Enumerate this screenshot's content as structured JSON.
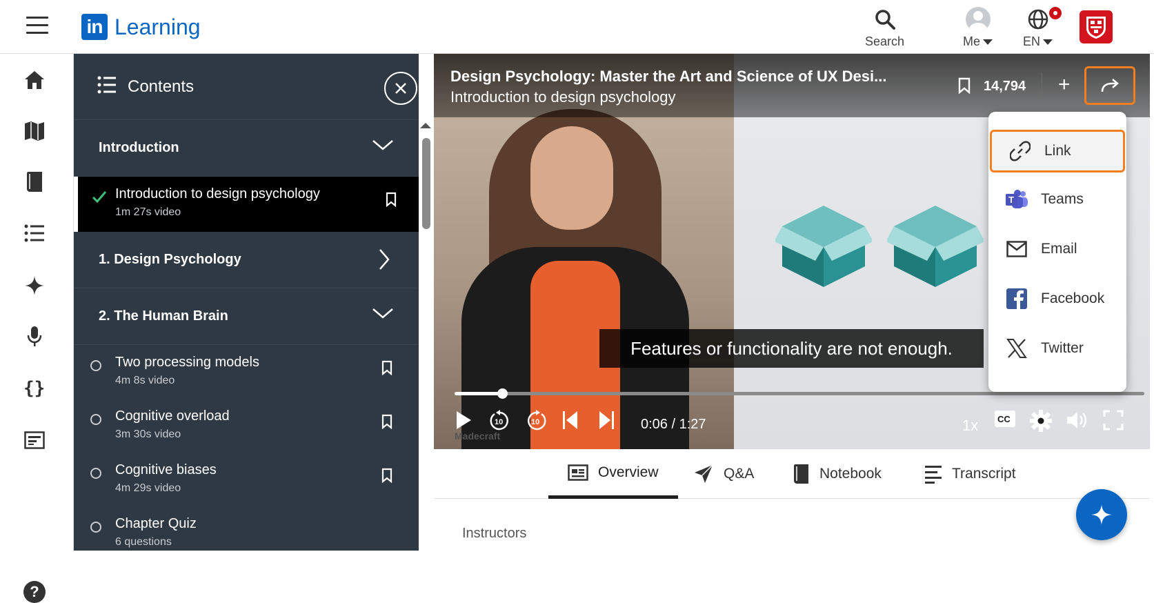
{
  "header": {
    "brand_mark": "in",
    "brand_name": "Learning",
    "search_label": "Search",
    "me_label": "Me",
    "language_label": "EN"
  },
  "left_nav": {
    "items": [
      "home-icon",
      "map-icon",
      "book-icon",
      "list-icon",
      "sparkle-icon",
      "microphone-icon",
      "code-icon",
      "certificate-icon"
    ],
    "help_label": "?"
  },
  "contents": {
    "title": "Contents",
    "sections": [
      {
        "title": "Introduction",
        "expanded": true,
        "lessons": [
          {
            "title": "Introduction to design psychology",
            "meta": "1m 27s video",
            "status": "completed",
            "active": true
          }
        ]
      },
      {
        "title": "1. Design Psychology",
        "expanded": false,
        "lessons": []
      },
      {
        "title": "2. The Human Brain",
        "expanded": true,
        "lessons": [
          {
            "title": "Two processing models",
            "meta": "4m 8s video",
            "status": "not-started"
          },
          {
            "title": "Cognitive overload",
            "meta": "3m 30s video",
            "status": "not-started"
          },
          {
            "title": "Cognitive biases",
            "meta": "4m 29s video",
            "status": "not-started"
          },
          {
            "title": "Chapter Quiz",
            "meta": "6 questions",
            "status": "not-started"
          }
        ]
      }
    ]
  },
  "player": {
    "course_title": "Design Psychology: Master the Art and Science of UX Desi...",
    "video_title": "Introduction to design psychology",
    "saves_count": "14,794",
    "caption": "Features or functionality are not enough.",
    "current_time": "0:06",
    "duration": "1:27",
    "time_display": "0:06 / 1:27",
    "progress": 0.069,
    "speed": "1x",
    "watermark": "Madecraft"
  },
  "share_menu": {
    "items": [
      {
        "label": "Link",
        "icon": "link-icon",
        "focused": true
      },
      {
        "label": "Teams",
        "icon": "teams-icon"
      },
      {
        "label": "Email",
        "icon": "email-icon"
      },
      {
        "label": "Facebook",
        "icon": "facebook-icon"
      },
      {
        "label": "Twitter",
        "icon": "x-icon"
      }
    ]
  },
  "tabs": [
    {
      "label": "Overview",
      "active": true
    },
    {
      "label": "Q&A"
    },
    {
      "label": "Notebook"
    },
    {
      "label": "Transcript"
    }
  ],
  "instructors_label": "Instructors",
  "colors": {
    "brand": "#0a66c2",
    "sidebar_bg": "#2f3943",
    "focus_outline": "#f57e20",
    "notification": "#cc1016",
    "org_badge": "#d3131e",
    "completed_check": "#3fbf7f"
  }
}
